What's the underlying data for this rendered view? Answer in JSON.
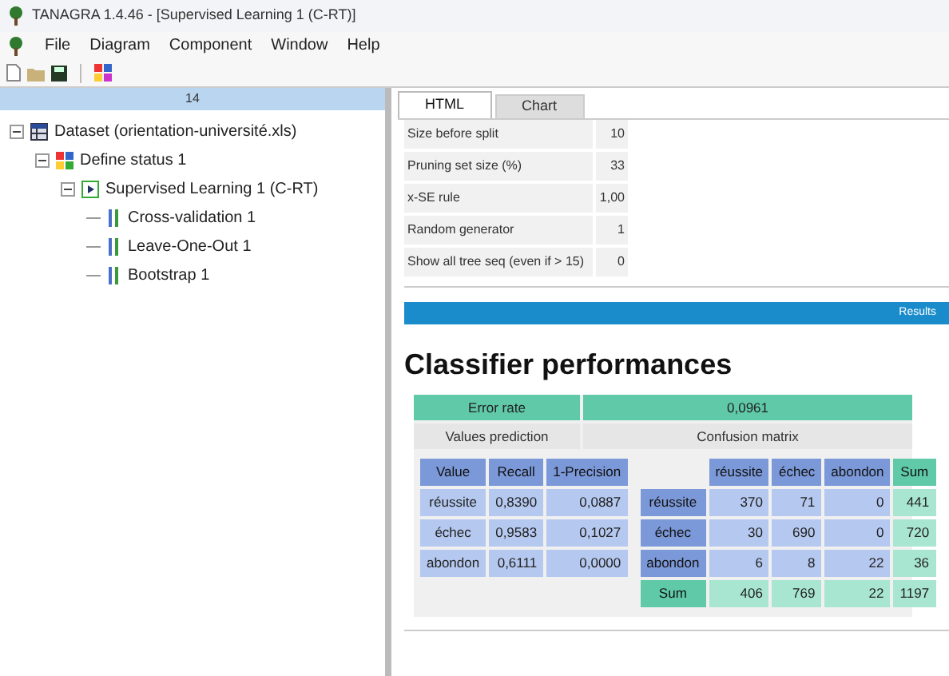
{
  "window": {
    "title": "TANAGRA 1.4.46 - [Supervised Learning 1 (C-RT)]"
  },
  "menu": [
    "File",
    "Diagram",
    "Component",
    "Window",
    "Help"
  ],
  "left_panel": {
    "header": "14",
    "tree": [
      {
        "label": "Dataset (orientation-université.xls)",
        "kind": "dataset",
        "expanded": true,
        "children": [
          {
            "label": "Define status 1",
            "kind": "status",
            "expanded": true,
            "children": [
              {
                "label": "Supervised Learning 1 (C-RT)",
                "kind": "learning",
                "expanded": true,
                "children": [
                  {
                    "label": "Cross-validation 1",
                    "kind": "component"
                  },
                  {
                    "label": "Leave-One-Out 1",
                    "kind": "component"
                  },
                  {
                    "label": "Bootstrap 1",
                    "kind": "component"
                  }
                ]
              }
            ]
          }
        ]
      }
    ]
  },
  "tabs": [
    {
      "label": "HTML",
      "selected": true
    },
    {
      "label": "Chart",
      "selected": false
    }
  ],
  "parameters": [
    {
      "name": "Size before split",
      "value": "10"
    },
    {
      "name": "Pruning set size (%)",
      "value": "33"
    },
    {
      "name": "x-SE rule",
      "value": "1,00"
    },
    {
      "name": "Random generator",
      "value": "1"
    },
    {
      "name": "Show all tree seq (even if > 15)",
      "value": "0"
    }
  ],
  "results_bar": "Results",
  "heading": "Classifier performances",
  "performance": {
    "error_rate_label": "Error rate",
    "error_rate": "0,0961",
    "values_prediction_label": "Values prediction",
    "confusion_matrix_label": "Confusion matrix",
    "prediction_columns": [
      "Value",
      "Recall",
      "1-Precision"
    ],
    "prediction_rows": [
      [
        "réussite",
        "0,8390",
        "0,0887"
      ],
      [
        "échec",
        "0,9583",
        "0,1027"
      ],
      [
        "abondon",
        "0,6111",
        "0,0000"
      ]
    ],
    "matrix_columns": [
      "réussite",
      "échec",
      "abondon",
      "Sum"
    ],
    "matrix_rows": [
      {
        "label": "réussite",
        "cells": [
          "370",
          "71",
          "0",
          "441"
        ]
      },
      {
        "label": "échec",
        "cells": [
          "30",
          "690",
          "0",
          "720"
        ]
      },
      {
        "label": "abondon",
        "cells": [
          "6",
          "8",
          "22",
          "36"
        ]
      }
    ],
    "sum_row": {
      "label": "Sum",
      "cells": [
        "406",
        "769",
        "22",
        "1197"
      ]
    }
  }
}
